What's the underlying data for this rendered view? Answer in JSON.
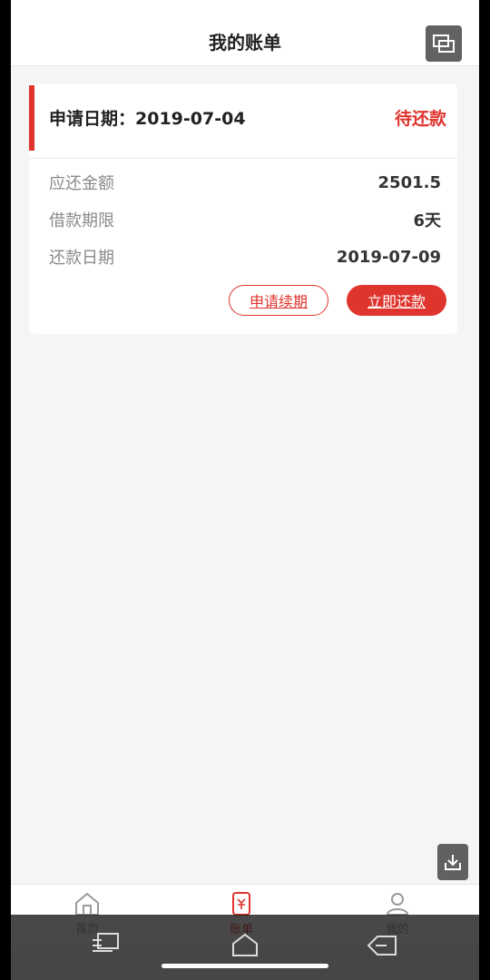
{
  "header": {
    "title": "我的账单"
  },
  "bill": {
    "apply_label": "申请日期：",
    "apply_date": "2019-07-04",
    "status": "待还款",
    "rows": [
      {
        "label": "应还金额",
        "value": "2501.5"
      },
      {
        "label": "借款期限",
        "value": "6天"
      },
      {
        "label": "还款日期",
        "value": "2019-07-09"
      }
    ],
    "renew_label": "申请续期",
    "repay_label": "立即还款"
  },
  "tabs": [
    {
      "label": "首页",
      "icon": "home-icon",
      "active": false
    },
    {
      "label": "账单",
      "icon": "bill-icon",
      "active": true
    },
    {
      "label": "我的",
      "icon": "profile-icon",
      "active": false
    }
  ],
  "colors": {
    "accent": "#e0342e",
    "text": "#222222",
    "muted": "#8a8a8a",
    "background": "#f5f5f5"
  }
}
